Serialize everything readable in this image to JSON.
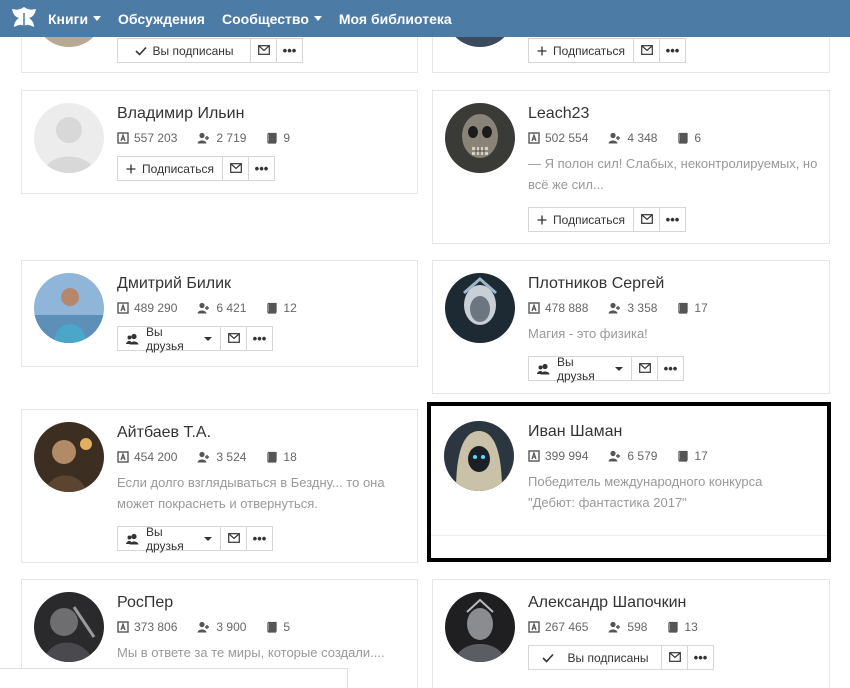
{
  "nav": {
    "items": [
      {
        "label": "Книги",
        "dropdown": true
      },
      {
        "label": "Обсуждения",
        "dropdown": false
      },
      {
        "label": "Сообщество",
        "dropdown": true
      },
      {
        "label": "Моя библиотека",
        "dropdown": false
      }
    ],
    "color": "#4c7ba5"
  },
  "cards": {
    "partial_left": {
      "button": "Вы подписаны"
    },
    "partial_right": {
      "button": "Подписаться"
    },
    "c1": {
      "name": "Владимир Ильин",
      "views": "557 203",
      "followers": "2 719",
      "books": "9",
      "button": "Подписаться"
    },
    "c2": {
      "name": "Leach23",
      "views": "502 554",
      "followers": "4 348",
      "books": "6",
      "bio": "— Я полон сил! Слабых, неконтролируемых, но всё же сил...",
      "button": "Подписаться"
    },
    "c3": {
      "name": "Дмитрий Билик",
      "views": "489 290",
      "followers": "6 421",
      "books": "12",
      "button": "Вы друзья"
    },
    "c4": {
      "name": "Плотников Сергей",
      "views": "478 888",
      "followers": "3 358",
      "books": "17",
      "bio": "Магия - это физика!",
      "button": "Вы друзья"
    },
    "c5": {
      "name": "Айтбаев Т.А.",
      "views": "454 200",
      "followers": "3 524",
      "books": "18",
      "bio": "Если долго взглядываться в Бездну... то она может покраснеть и отвернуться.",
      "button": "Вы друзья"
    },
    "c6": {
      "name": "Иван Шаман",
      "views": "399 994",
      "followers": "6 579",
      "books": "17",
      "bio": "Победитель международного конкурса \"Дебют: фантастика 2017\""
    },
    "c7": {
      "name": "РосПер",
      "views": "373 806",
      "followers": "3 900",
      "books": "5",
      "bio": "Мы в ответе за те миры, которые создали...."
    },
    "c8": {
      "name": "Александр Шапочкин",
      "views": "267 465",
      "followers": "598",
      "books": "13",
      "button": "Вы подписаны"
    }
  },
  "icons": {
    "views": "views-icon",
    "followers": "followers-icon",
    "books": "books-icon",
    "plus": "plus-icon",
    "check": "check-icon",
    "friends": "friends-icon",
    "mail": "mail-icon",
    "more": "more-icon"
  }
}
